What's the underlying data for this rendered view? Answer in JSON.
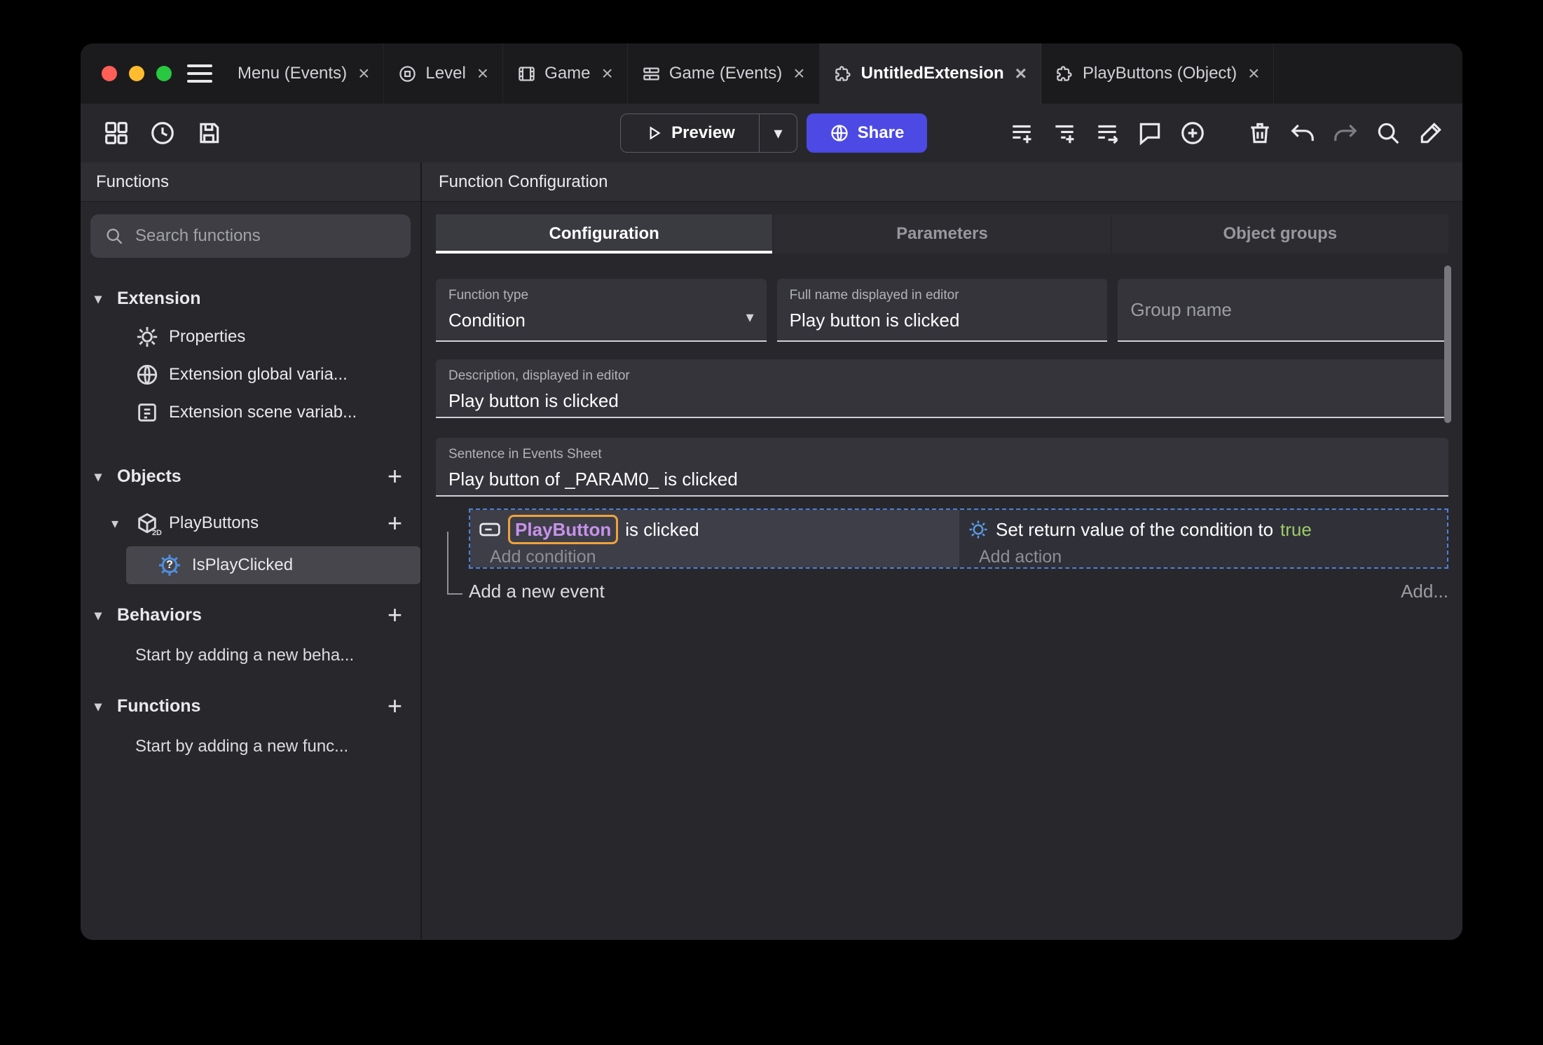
{
  "icons": {
    "close": "×",
    "plus": "+",
    "chevron_down": "▾",
    "dropdown_arrow": "▾",
    "question": "?"
  },
  "tabs": [
    {
      "label": "Menu (Events)"
    },
    {
      "label": "Level"
    },
    {
      "label": "Game"
    },
    {
      "label": "Game (Events)"
    },
    {
      "label": "UntitledExtension"
    },
    {
      "label": "PlayButtons (Object)"
    }
  ],
  "toolbar": {
    "preview_label": "Preview",
    "share_label": "Share"
  },
  "sidebar": {
    "title": "Functions",
    "search_placeholder": "Search functions",
    "extension_section": "Extension",
    "extension_items": [
      "Properties",
      "Extension global varia...",
      "Extension scene variab..."
    ],
    "objects_section": "Objects",
    "objects_items": [
      "PlayButtons"
    ],
    "functions_items": [
      "IsPlayClicked"
    ],
    "behaviors_section": "Behaviors",
    "behaviors_hint": "Start by adding a new beha...",
    "functions_section": "Functions",
    "functions_hint": "Start by adding a new func..."
  },
  "main": {
    "title": "Function Configuration",
    "tabs": [
      "Configuration",
      "Parameters",
      "Object groups"
    ],
    "fields": {
      "function_type_label": "Function type",
      "function_type_value": "Condition",
      "full_name_label": "Full name displayed in editor",
      "full_name_value": "Play button is clicked",
      "group_name_placeholder": "Group name",
      "description_label": "Description, displayed in editor",
      "description_value": "Play button is clicked",
      "sentence_label": "Sentence in Events Sheet",
      "sentence_value": "Play button of _PARAM0_ is clicked"
    },
    "events": {
      "condition_object": "PlayButton",
      "condition_text": "is clicked",
      "add_condition": "Add condition",
      "action_text": "Set return value of the condition to",
      "action_value": "true",
      "add_action": "Add action",
      "add_event": "Add a new event",
      "add_more": "Add..."
    }
  },
  "colors": {
    "accent": "#4C49E5",
    "object_chip": "#C792EA",
    "chip_border": "#EFA33C",
    "true_green": "#9CCC65"
  }
}
